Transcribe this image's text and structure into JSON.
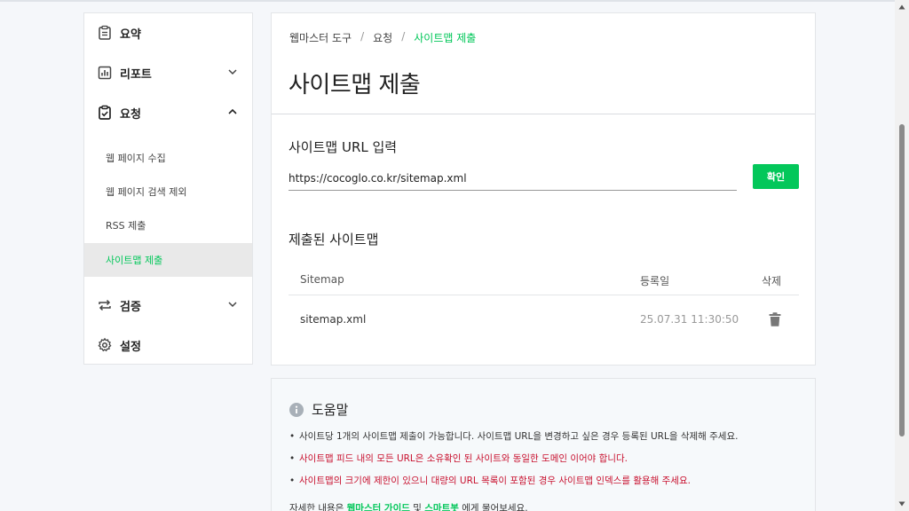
{
  "sidebar": {
    "items": [
      {
        "label": "요약",
        "icon": "clipboard-icon"
      },
      {
        "label": "리포트",
        "icon": "chart-icon",
        "expanded": false
      },
      {
        "label": "요청",
        "icon": "checkbox-clipboard-icon",
        "expanded": true
      },
      {
        "label": "검증",
        "icon": "repeat-icon",
        "expanded": false
      },
      {
        "label": "설정",
        "icon": "gear-icon"
      }
    ],
    "subitems": [
      {
        "label": "웹 페이지 수집"
      },
      {
        "label": "웹 페이지 검색 제외"
      },
      {
        "label": "RSS 제출"
      },
      {
        "label": "사이트맵 제출",
        "active": true
      }
    ]
  },
  "breadcrumb": {
    "items": [
      "웹마스터 도구",
      "요청",
      "사이트맵 제출"
    ],
    "separator": "/"
  },
  "page": {
    "title": "사이트맵 제출"
  },
  "url_section": {
    "label": "사이트맵 URL 입력",
    "value": "https://cocoglo.co.kr/sitemap.xml",
    "button": "확인"
  },
  "submitted": {
    "label": "제출된 사이트맵",
    "columns": {
      "sitemap": "Sitemap",
      "date": "등록일",
      "delete": "삭제"
    },
    "rows": [
      {
        "sitemap": "sitemap.xml",
        "date": "25.07.31 11:30:50"
      }
    ]
  },
  "help": {
    "title": "도움말",
    "items": [
      {
        "text": "사이트당 1개의 사이트맵 제출이 가능합니다. 사이트맵 URL을 변경하고 싶은 경우 등록된 URL을 삭제해 주세요.",
        "warn": false
      },
      {
        "text": "사이트맵 피드 내의 모든 URL은 소유확인 된 사이트와 동일한 도메인 이어야 합니다.",
        "warn": true
      },
      {
        "text": "사이트맵의 크기에 제한이 있으니 대량의 URL 목록이 포함된 경우 사이트맵 인덱스를 활용해 주세요.",
        "warn": true
      }
    ],
    "more_prefix": "자세한 내용은 ",
    "more_link1": "웹마스터 가이드",
    "more_mid": " 및 ",
    "more_link2": "스마트봇",
    "more_suffix": " 에게 물어보세요."
  },
  "colors": {
    "accent": "#03c75a",
    "warning": "#c8102e"
  }
}
